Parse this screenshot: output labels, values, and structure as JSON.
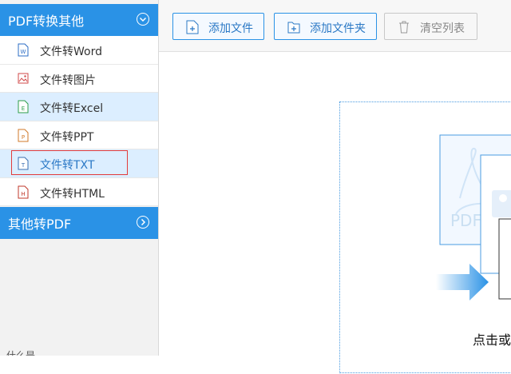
{
  "sidebar": {
    "section1": {
      "title": "PDF转换其他"
    },
    "items": [
      {
        "label": "文件转Word",
        "icon": "word-file-icon",
        "letter": "W",
        "color": "#2b6cc4"
      },
      {
        "label": "文件转图片",
        "icon": "image-file-icon",
        "letter": "",
        "color": "#d04a4a"
      },
      {
        "label": "文件转Excel",
        "icon": "excel-file-icon",
        "letter": "E",
        "color": "#2e9d4a"
      },
      {
        "label": "文件转PPT",
        "icon": "ppt-file-icon",
        "letter": "P",
        "color": "#d07a2a"
      },
      {
        "label": "文件转TXT",
        "icon": "txt-file-icon",
        "letter": "T",
        "color": "#3a6fb0"
      },
      {
        "label": "文件转HTML",
        "icon": "html-file-icon",
        "letter": "H",
        "color": "#c0392b"
      }
    ],
    "section2": {
      "title": "其他转PDF"
    },
    "bottom_text": "什么是"
  },
  "toolbar": {
    "add_file": "添加文件",
    "add_folder": "添加文件夹",
    "clear_list": "清空列表"
  },
  "main": {
    "drop_hint": "点击或",
    "pdf_label": "PDF"
  },
  "watermark": "@",
  "colors": {
    "accent": "#2a92e6",
    "selected_row": "#dceeff",
    "highlight_border": "#e23b3b"
  }
}
